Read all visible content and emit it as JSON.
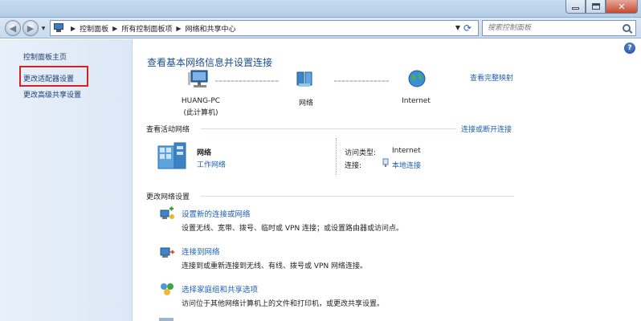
{
  "address_bar": {
    "breadcrumb": [
      "控制面板",
      "所有控制面板项",
      "网络和共享中心"
    ]
  },
  "search": {
    "placeholder": "搜索控制面板"
  },
  "sidebar": {
    "items": [
      {
        "label": "控制面板主页"
      },
      {
        "label": "更改适配器设置"
      },
      {
        "label": "更改高级共享设置"
      }
    ]
  },
  "main": {
    "title": "查看基本网络信息并设置连接",
    "full_map_link": "查看完整映射",
    "map": {
      "computer_name": "HUANG-PC",
      "computer_sub": "(此计算机)",
      "network_label": "网络",
      "internet_label": "Internet"
    },
    "active_networks": {
      "heading": "查看活动网络",
      "connect_link": "连接或断开连接",
      "network_name": "网络",
      "network_type": "工作网络",
      "access_type_label": "访问类型:",
      "access_type_value": "Internet",
      "connection_label": "连接:",
      "connection_value": "本地连接"
    },
    "change_settings": {
      "heading": "更改网络设置",
      "tasks": [
        {
          "title": "设置新的连接或网络",
          "desc": "设置无线、宽带、拨号、临时或 VPN 连接；或设置路由器或访问点。"
        },
        {
          "title": "连接到网络",
          "desc": "连接到或重新连接到无线、有线、拨号或 VPN 网络连接。"
        },
        {
          "title": "选择家庭组和共享选项",
          "desc": "访问位于其他网络计算机上的文件和打印机，或更改共享设置。"
        }
      ]
    }
  }
}
